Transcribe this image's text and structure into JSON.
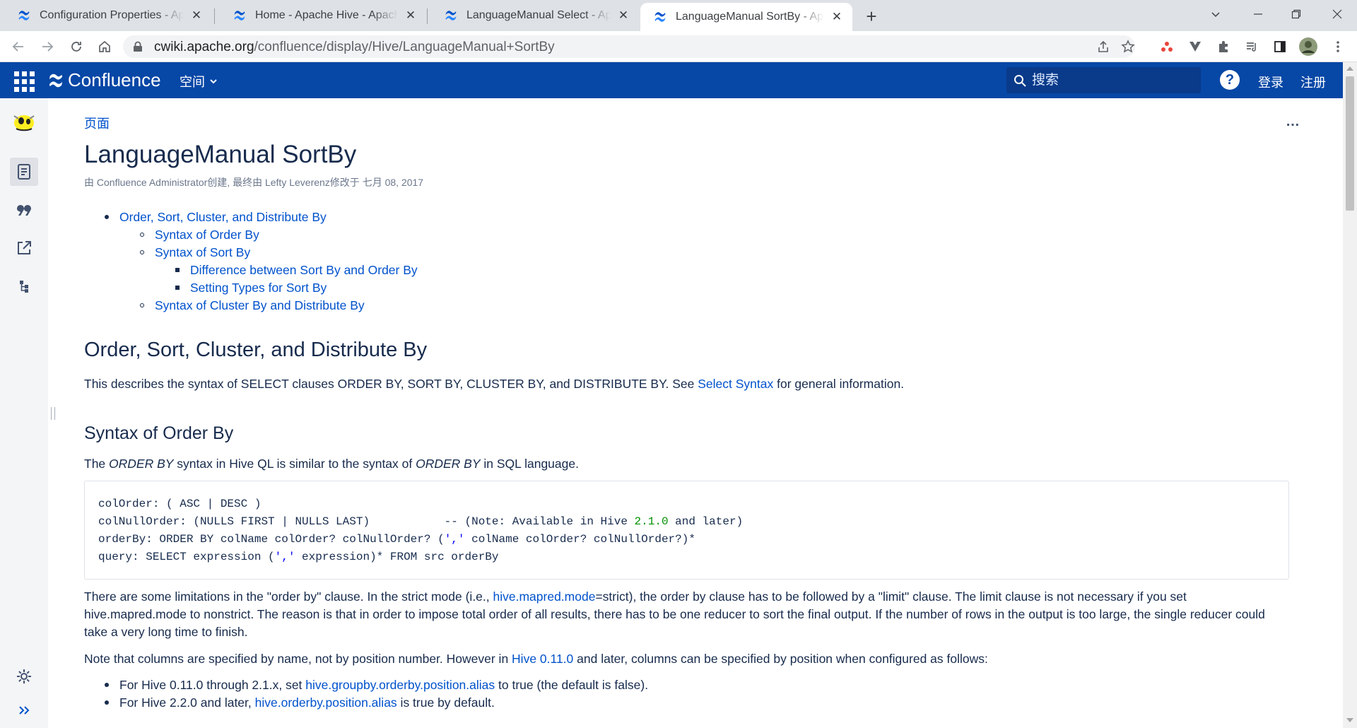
{
  "browser": {
    "tabs": [
      {
        "title": "Configuration Properties - Apache Hive - Apache Software Foundation"
      },
      {
        "title": "Home - Apache Hive - Apache Software Foundation"
      },
      {
        "title": "LanguageManual Select - Apache Hive - Apache Software Foundation"
      },
      {
        "title": "LanguageManual SortBy - Apache Hive - Apache Software Foundation"
      }
    ],
    "url_host": "cwiki.apache.org",
    "url_path": "/confluence/display/Hive/LanguageManual+SortBy"
  },
  "header": {
    "brand": "Confluence",
    "spaces_label": "空间",
    "search_placeholder": "搜索",
    "help_symbol": "?",
    "login": "登录",
    "signup": "注册"
  },
  "page": {
    "breadcrumb": "页面",
    "more": "…",
    "title": "LanguageManual SortBy",
    "meta": "由 Confluence Administrator创建, 最终由 Lefty Leverenz修改于 七月 08, 2017",
    "toc": [
      {
        "level": 1,
        "text": "Order, Sort, Cluster, and Distribute By"
      },
      {
        "level": 2,
        "text": "Syntax of Order By"
      },
      {
        "level": 2,
        "text": "Syntax of Sort By"
      },
      {
        "level": 3,
        "text": "Difference between Sort By and Order By"
      },
      {
        "level": 3,
        "text": "Setting Types for Sort By"
      },
      {
        "level": 2,
        "text": "Syntax of Cluster By and Distribute By"
      }
    ],
    "h1": "Order, Sort, Cluster, and Distribute By",
    "intro_before": "This describes the syntax of SELECT clauses ORDER BY, SORT BY, CLUSTER BY, and DISTRIBUTE BY.  See ",
    "intro_link": "Select Syntax",
    "intro_after": " for general information.",
    "h2_order": "Syntax of Order By",
    "order_p": {
      "t1": "The ",
      "e1": "ORDER BY",
      "t2": " syntax in Hive QL is similar to the syntax of ",
      "e2": "ORDER BY",
      "t3": " in SQL language."
    },
    "code": {
      "l1": "colOrder: ( ASC | DESC )",
      "l2a": "colNullOrder: (NULLS FIRST | NULLS LAST)           -- (Note: Available in Hive ",
      "l2num": "2.1.0",
      "l2b": " and later)",
      "l3a": "orderBy: ORDER BY colName colOrder? colNullOrder? (",
      "l3str": "','",
      "l3b": " colName colOrder? colNullOrder?)*",
      "l4a": "query: SELECT expression (",
      "l4str": "','",
      "l4b": " expression)* FROM src orderBy"
    },
    "limit_p": {
      "t1": "There are some limitations in the \"order by\" clause. In the strict mode (i.e., ",
      "link": "hive.mapred.mode",
      "t2": "=strict), the order by clause has to be followed by a \"limit\" clause. The limit clause is not necessary if you set hive.mapred.mode to nonstrict. The reason is that in order to impose total order of all results, there has to be one reducer to sort the final output. If the number of rows in the output is too large, the single reducer could take a very long time to finish."
    },
    "note_p": {
      "t1": "Note that columns are specified by name, not by position number. However in ",
      "link": "Hive 0.11.0",
      "t2": " and later, columns can be specified by position when configured as follows:"
    },
    "bullets": [
      {
        "t1": "For Hive 0.11.0 through 2.1.x, set ",
        "link": "hive.groupby.orderby.position.alias",
        "t2": " to true (the default is false)."
      },
      {
        "t1": "For Hive 2.2.0 and later, ",
        "link": "hive.orderby.position.alias",
        "t2": " is true by default."
      }
    ]
  },
  "colors": {
    "header_bg": "#0747a6",
    "link": "#0052cc",
    "text": "#172b4d"
  }
}
